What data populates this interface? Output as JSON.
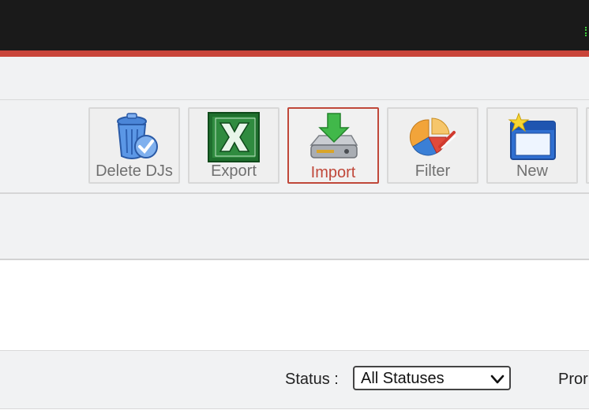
{
  "toolbar": {
    "buttons": [
      {
        "label": "Delete DJs",
        "icon": "trash-check-icon"
      },
      {
        "label": "Export",
        "icon": "excel-icon"
      },
      {
        "label": "Import",
        "icon": "import-drive-icon",
        "active": true
      },
      {
        "label": "Filter",
        "icon": "pie-filter-icon"
      },
      {
        "label": "New",
        "icon": "new-window-star-icon"
      }
    ]
  },
  "filters": {
    "status_label": "Status :",
    "status_value": "All Statuses",
    "next_label": "Pror"
  },
  "colors": {
    "topbar": "#1a1a1a",
    "accent_red": "#c9453a",
    "band": "#f1f2f3"
  }
}
